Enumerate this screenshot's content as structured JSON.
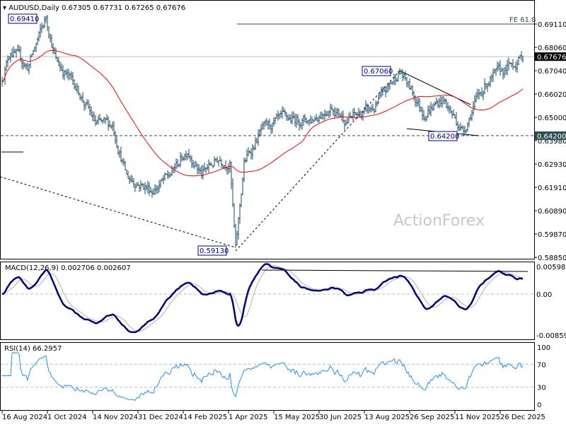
{
  "header": {
    "symbol": "AUDUSD,Daily",
    "open": "0.67305",
    "high": "0.67731",
    "low": "0.67265",
    "close": "0.67676"
  },
  "watermark": "ActionForex",
  "colors": {
    "bars": "#1a4a66",
    "ma": "#ff0000",
    "macd": "#000080",
    "signal": "#b0b0b0",
    "rsi": "#1e90ff",
    "fe_line": "#2f4f4f"
  },
  "chart_data": {
    "type": "ohlc",
    "title": "AUDUSD,Daily",
    "price_axis": {
      "ticks": [
        "0.69110",
        "0.68060",
        "0.67040",
        "0.66020",
        "0.65000",
        "0.63980",
        "0.62930",
        "0.61910",
        "0.60890",
        "0.59870",
        "0.58850"
      ],
      "range": [
        0.5885,
        0.6911
      ]
    },
    "x_ticks": [
      "16 Aug 2024",
      "1 Oct 2024",
      "14 Nov 2024",
      "31 Dec 2024",
      "14 Feb 2025",
      "1 Apr 2025",
      "15 May 2025",
      "30 Jun 2025",
      "13 Aug 2025",
      "26 Sep 2025",
      "11 Nov 2025",
      "26 Dec 2025"
    ],
    "close_keypoints_bar_index_price": [
      [
        0,
        0.6675
      ],
      [
        6,
        0.68
      ],
      [
        18,
        0.672
      ],
      [
        31,
        0.694
      ],
      [
        38,
        0.675
      ],
      [
        53,
        0.663
      ],
      [
        66,
        0.647
      ],
      [
        78,
        0.647
      ],
      [
        88,
        0.624
      ],
      [
        106,
        0.618
      ],
      [
        118,
        0.624
      ],
      [
        131,
        0.636
      ],
      [
        141,
        0.625
      ],
      [
        153,
        0.632
      ],
      [
        161,
        0.63
      ],
      [
        165,
        0.5913
      ],
      [
        171,
        0.63
      ],
      [
        183,
        0.644
      ],
      [
        198,
        0.649
      ],
      [
        218,
        0.649
      ],
      [
        233,
        0.655
      ],
      [
        243,
        0.649
      ],
      [
        263,
        0.654
      ],
      [
        281,
        0.6706
      ],
      [
        298,
        0.652
      ],
      [
        311,
        0.658
      ],
      [
        326,
        0.644
      ],
      [
        333,
        0.655
      ],
      [
        343,
        0.666
      ],
      [
        358,
        0.672
      ],
      [
        368,
        0.67676
      ]
    ],
    "current_price": {
      "label": "0.67676",
      "value": 0.67676
    },
    "levels": [
      {
        "label": "FE 61.8",
        "value": 0.6911
      },
      {
        "label": "0.64200",
        "value": 0.642
      }
    ],
    "annotations": [
      {
        "label": "0.69410",
        "value": 0.6941
      },
      {
        "label": "0.67060",
        "value": 0.6706
      },
      {
        "label": "0.64200",
        "value": 0.642
      },
      {
        "label": "0.59130",
        "value": 0.5913
      }
    ],
    "macd": {
      "label": "MACD(12,26,9) 0.002706 0.002607",
      "ticks": [
        "0.005981",
        "0.00",
        "-0.00859"
      ],
      "range": [
        -0.00859,
        0.005981
      ]
    },
    "rsi": {
      "label": "RSI(14) 66.2957",
      "ticks": [
        "100",
        "70",
        "30",
        "0"
      ],
      "range": [
        0,
        100
      ]
    }
  }
}
